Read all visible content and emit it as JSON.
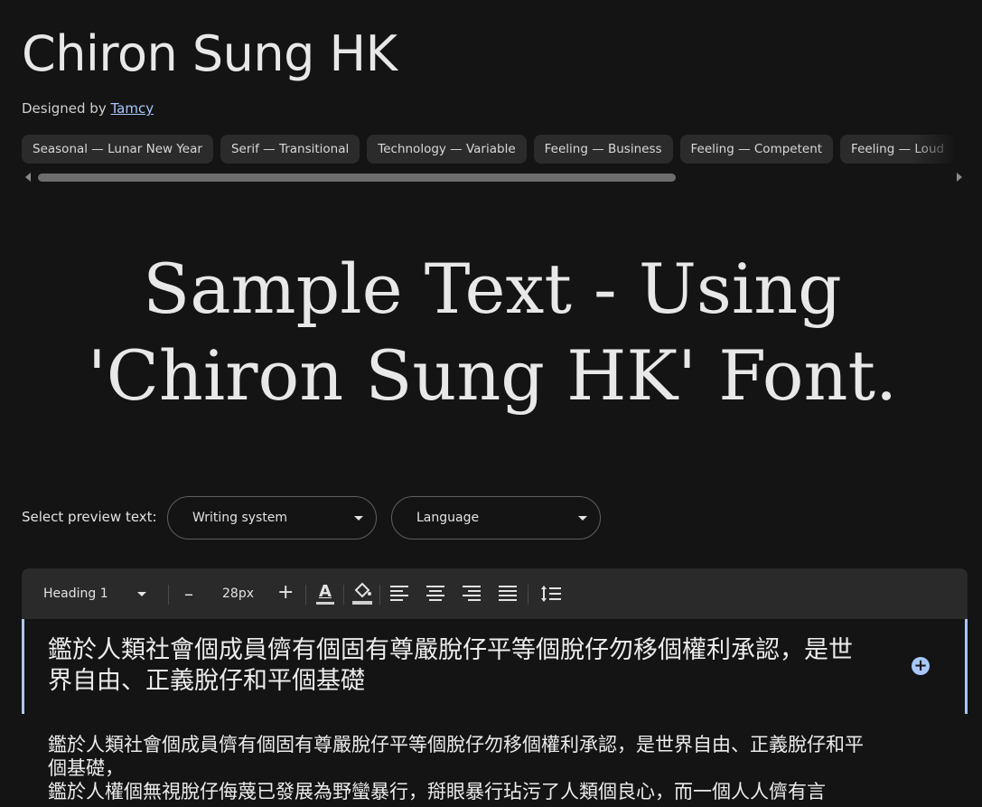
{
  "header": {
    "font_name": "Chiron Sung HK",
    "designed_by_prefix": "Designed by ",
    "designer": "Tamcy"
  },
  "tags": [
    "Seasonal — Lunar New Year",
    "Serif — Transitional",
    "Technology — Variable",
    "Feeling — Business",
    "Feeling — Competent",
    "Feeling — Loud"
  ],
  "hero": {
    "sample_text": "Sample Text - Using 'Chiron Sung HK' Font."
  },
  "preview": {
    "label": "Select preview text:",
    "writing_system": "Writing system",
    "language": "Language"
  },
  "toolbar": {
    "style": "Heading 1",
    "decrease": "–",
    "size": "28px",
    "increase": "+",
    "text_color_glyph": "A"
  },
  "editor": {
    "heading": "鑑於人類社會個成員儕有個固有尊嚴脫仔平等個脫仔勿移個權利承認，是世界自由、正義脫仔和平個基礎",
    "paragraphs": [
      "鑑於人類社會個成員儕有個固有尊嚴脫仔平等個脫仔勿移個權利承認，是世界自由、正義脫仔和平個基礎，",
      "鑑於人權個無視脫仔侮蔑已發展為野蠻暴行，搿眼暴行玷污了人類個良心，而一個人人儕有言"
    ]
  },
  "colors": {
    "background": "#141414",
    "accent": "#a8c7fa",
    "chip": "#2b2b2b",
    "toolbar": "#2a2a2a"
  }
}
